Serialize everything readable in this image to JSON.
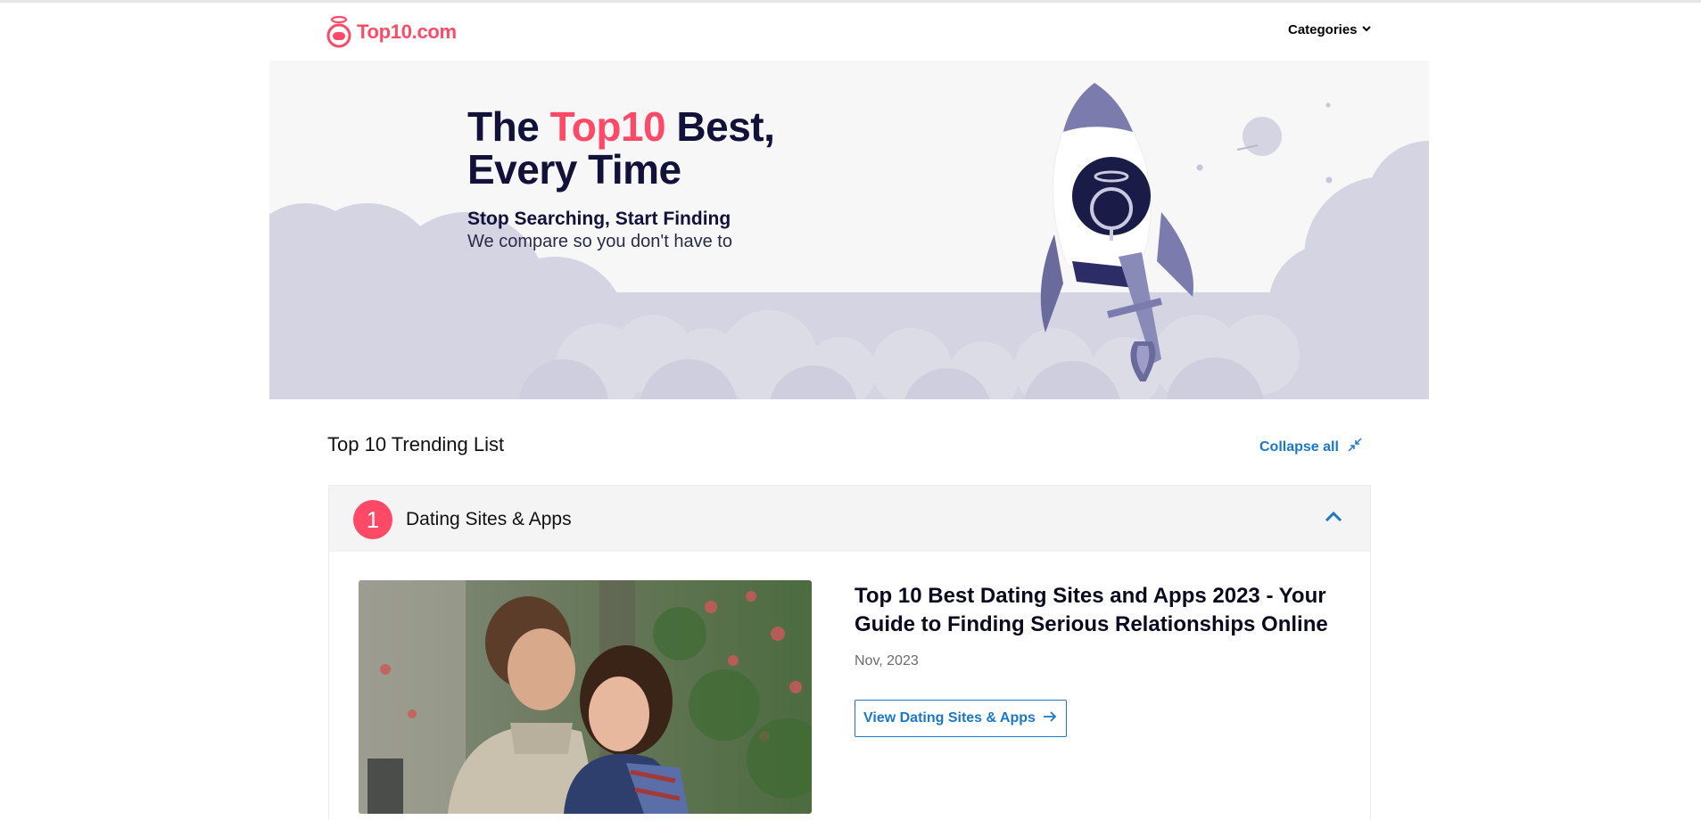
{
  "header": {
    "logo_text": "Top10.com",
    "logo_icon": "robot-logo-icon",
    "categories_label": "Categories",
    "categories_icon": "chevron-down-icon"
  },
  "hero": {
    "title_part1": "The ",
    "title_accent": "Top10",
    "title_part2": " Best,",
    "title_line2": "Every Time",
    "subtitle": "Stop Searching, Start Finding",
    "tagline": "We compare so you don't have to",
    "illustration": "rocket-icon"
  },
  "trending": {
    "title": "Top 10 Trending List",
    "collapse_label": "Collapse all",
    "collapse_icon": "collapse-arrows-icon",
    "items": [
      {
        "rank": "1",
        "label": "Dating Sites & Apps",
        "article_title": "Top 10 Best Dating Sites and Apps 2023 - Your Guide to Finding Serious Relationships Online",
        "date": "Nov, 2023",
        "button_label": "View Dating Sites & Apps",
        "button_icon": "arrow-right-icon",
        "toggle_icon": "chevron-up-icon"
      }
    ]
  },
  "colors": {
    "brand": "#ff4a67",
    "navy": "#11113a",
    "link": "#1b78c8",
    "cloud": "#d4d4e2"
  }
}
